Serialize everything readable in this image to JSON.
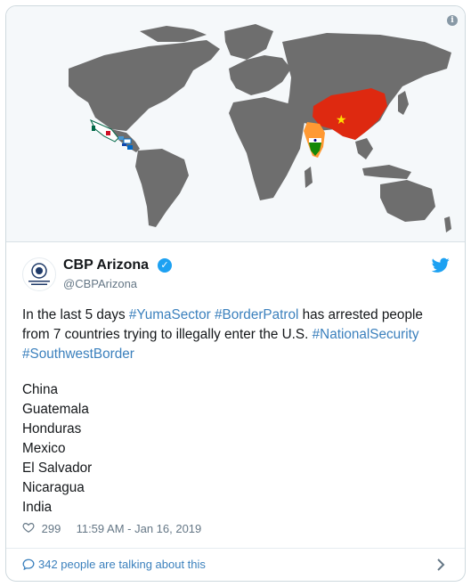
{
  "map": {
    "info_glyph": "i",
    "land_color": "#6e6e6e",
    "ocean_color": "#f5f8fa",
    "highlight_countries": [
      "China",
      "India",
      "Mexico",
      "Guatemala",
      "Honduras",
      "El Salvador",
      "Nicaragua"
    ]
  },
  "tweet": {
    "display_name": "CBP Arizona",
    "handle": "@CBPArizona",
    "verified": true,
    "text_prefix": "In the last 5 days ",
    "hashtag_1": "#YumaSector",
    "hashtag_2": "#BorderPatrol",
    "text_middle": " has arrested people from 7 countries trying to illegally enter the U.S. ",
    "hashtag_3": "#NationalSecurity",
    "hashtag_4": "#SouthwestBorder",
    "countries": [
      "China",
      "Guatemala",
      "Honduras",
      "Mexico",
      "El Salvador",
      "Nicaragua",
      "India"
    ],
    "likes": "299",
    "timestamp": "11:59 AM - Jan 16, 2019"
  },
  "footer": {
    "talking_text": "342 people are talking about this"
  },
  "colors": {
    "link": "#3b80bd",
    "verified": "#1da1f2",
    "china_red": "#de2910",
    "india_orange": "#ff9933",
    "india_green": "#138808"
  },
  "icons": {
    "info": "info-icon",
    "verified": "verified-badge-icon",
    "twitter": "twitter-bird-icon",
    "like": "heart-icon",
    "reply": "speech-bubble-icon",
    "chevron": "chevron-right-icon"
  }
}
